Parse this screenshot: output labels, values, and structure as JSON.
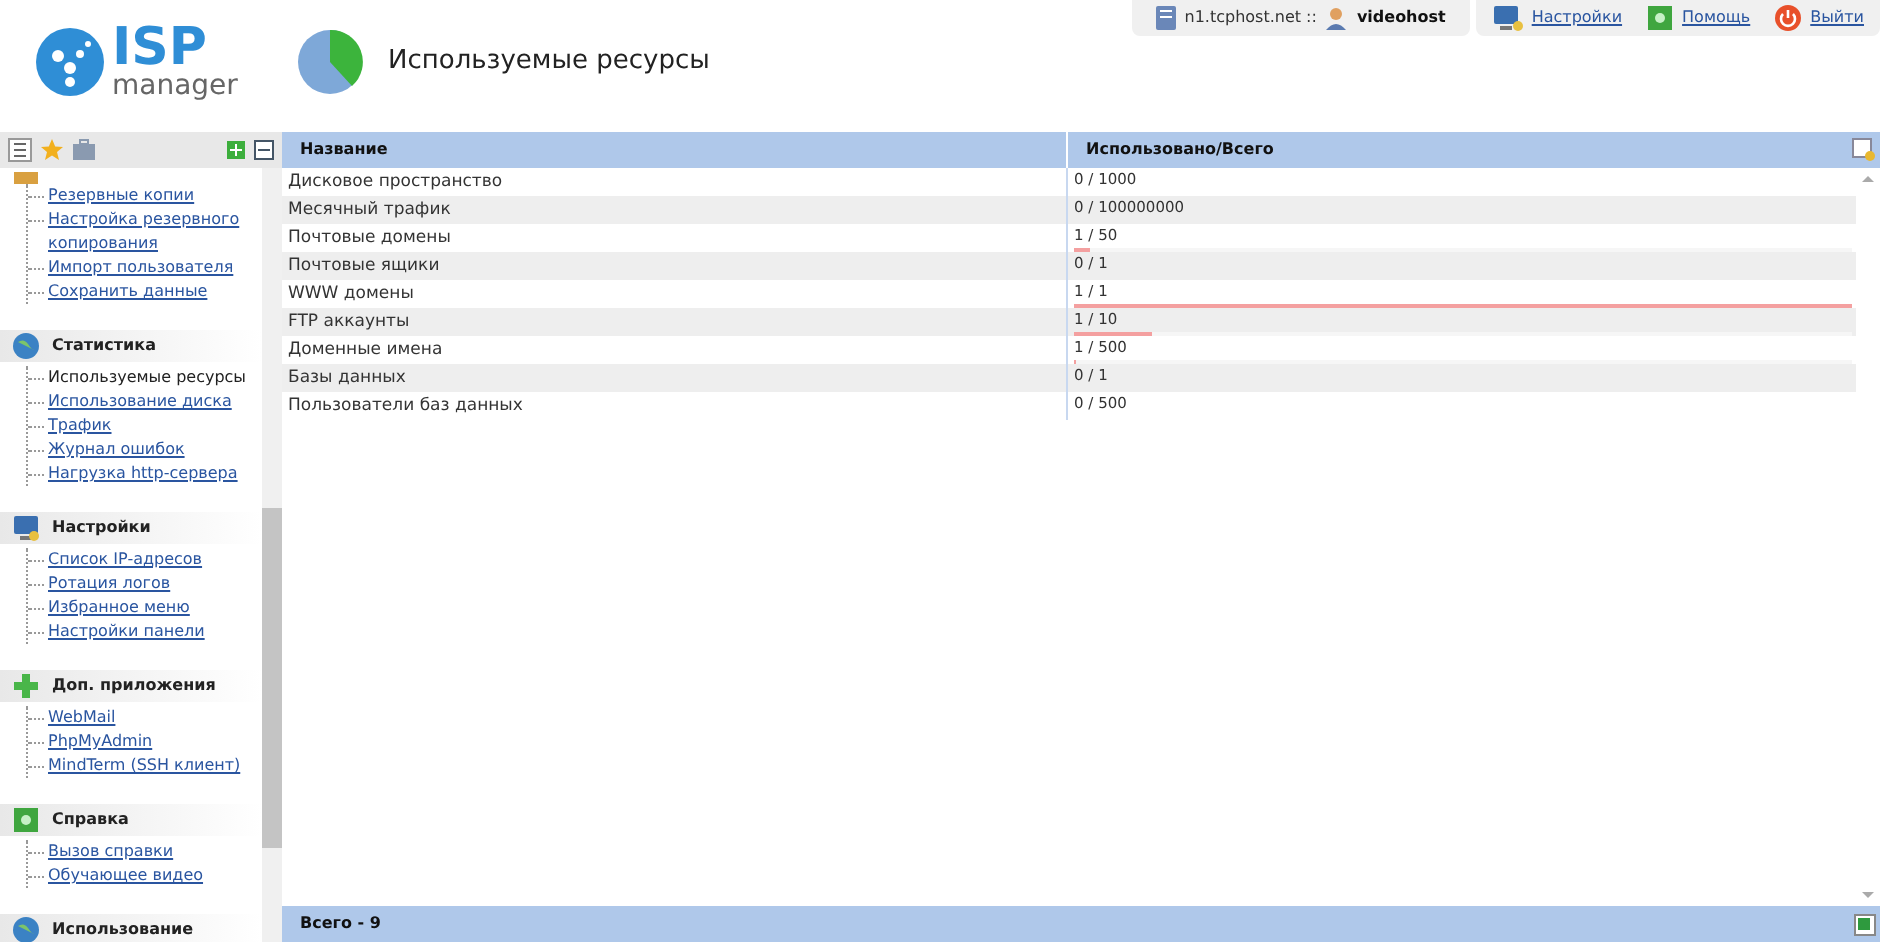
{
  "header": {
    "logo_top": "ISP",
    "logo_bottom": "manager",
    "page_title": "Используемые ресурсы",
    "server": "n1.tcphost.net ::",
    "user": "videohost",
    "links": [
      {
        "label": "Настройки",
        "kind": "settings"
      },
      {
        "label": "Помощь",
        "kind": "help"
      },
      {
        "label": "Выйти",
        "kind": "logout"
      }
    ]
  },
  "sidebar": {
    "groups": [
      {
        "kind": "service",
        "items": [
          {
            "label": "Резервные копии",
            "selected": false
          },
          {
            "label": "Настройка резервного копирования",
            "selected": false
          },
          {
            "label": "Импорт пользователя",
            "selected": false
          },
          {
            "label": "Сохранить данные",
            "selected": false
          }
        ]
      },
      {
        "title": "Статистика",
        "kind": "stats",
        "items": [
          {
            "label": "Используемые ресурсы",
            "selected": true
          },
          {
            "label": "Использование диска",
            "selected": false
          },
          {
            "label": "Трафик",
            "selected": false
          },
          {
            "label": "Журнал ошибок",
            "selected": false
          },
          {
            "label": "Нагрузка http-сервера",
            "selected": false
          }
        ]
      },
      {
        "title": "Настройки",
        "kind": "settings",
        "items": [
          {
            "label": "Список IP-адресов",
            "selected": false
          },
          {
            "label": "Ротация логов",
            "selected": false
          },
          {
            "label": "Избранное меню",
            "selected": false
          },
          {
            "label": "Настройки панели",
            "selected": false
          }
        ]
      },
      {
        "title": "Доп. приложения",
        "kind": "apps",
        "items": [
          {
            "label": "WebMail",
            "selected": false
          },
          {
            "label": "PhpMyAdmin",
            "selected": false
          },
          {
            "label": "MindTerm (SSH клиент)",
            "selected": false
          }
        ]
      },
      {
        "title": "Справка",
        "kind": "help",
        "items": [
          {
            "label": "Вызов справки",
            "selected": false
          },
          {
            "label": "Обучающее видео",
            "selected": false
          }
        ]
      },
      {
        "title": "Использование",
        "kind": "stats"
      }
    ]
  },
  "table": {
    "columns": [
      "Название",
      "Использовано/Всего"
    ],
    "rows": [
      {
        "name": "Дисковое пространство",
        "used": "0 / 1000"
      },
      {
        "name": "Месячный трафик",
        "used": "0 / 100000000"
      },
      {
        "name": "Почтовые домены",
        "used": "1 / 50",
        "level": 0.02
      },
      {
        "name": "Почтовые ящики",
        "used": "0 / 1"
      },
      {
        "name": "WWW домены",
        "used": "1 / 1",
        "level": 1
      },
      {
        "name": "FTP аккаунты",
        "used": "1 / 10",
        "level": 0.1
      },
      {
        "name": "Доменные имена",
        "used": "1 / 500",
        "level": 0.002
      },
      {
        "name": "Базы данных",
        "used": "0 / 1"
      },
      {
        "name": "Пользователи баз данных",
        "used": "0 / 500"
      }
    ],
    "footer": "Всего - 9"
  }
}
